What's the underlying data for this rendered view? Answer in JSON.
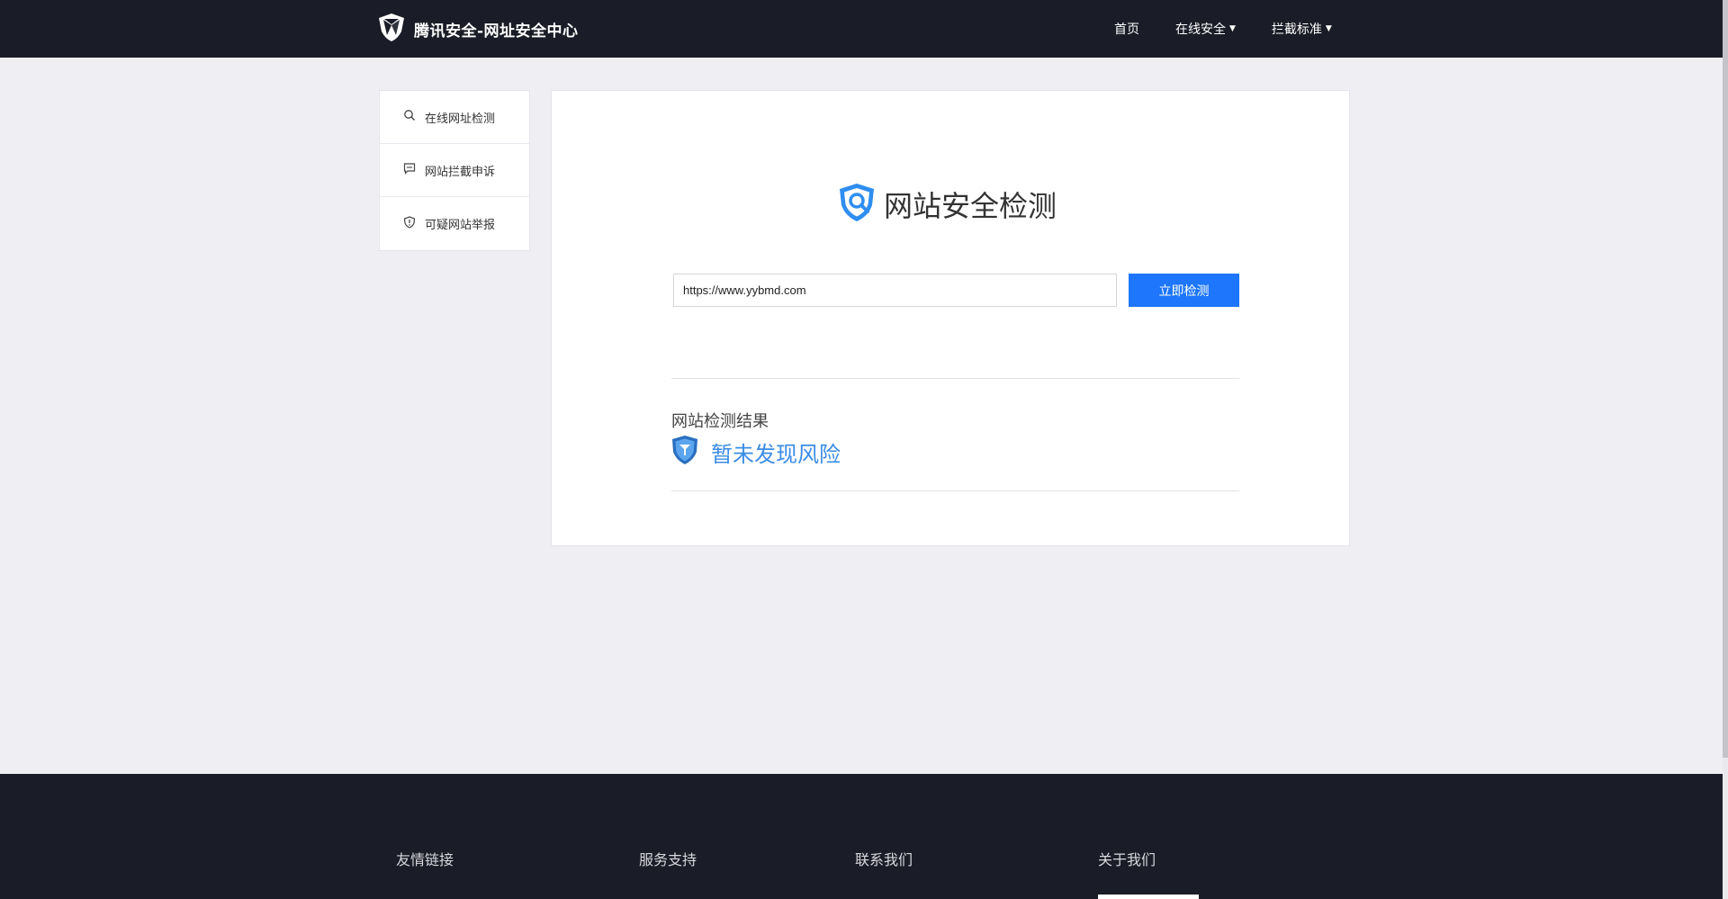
{
  "header": {
    "logo_text": "腾讯安全-网址安全中心",
    "nav": [
      {
        "label": "首页"
      },
      {
        "label": "在线安全"
      },
      {
        "label": "拦截标准"
      }
    ]
  },
  "sidebar": {
    "items": [
      {
        "label": "在线网址检测",
        "icon": "search-icon"
      },
      {
        "label": "网站拦截申诉",
        "icon": "chat-icon"
      },
      {
        "label": "可疑网站举报",
        "icon": "shield-alert-icon"
      }
    ]
  },
  "main": {
    "title": "网站安全检测",
    "url_value": "https://www.yybmd.com",
    "check_button": "立即检测",
    "result_label": "网站检测结果",
    "result_status": "暂未发现风险"
  },
  "footer": {
    "columns": [
      {
        "label": "友情链接"
      },
      {
        "label": "服务支持"
      },
      {
        "label": "联系我们"
      },
      {
        "label": "关于我们"
      }
    ]
  },
  "colors": {
    "header_bg": "#1a1c27",
    "page_bg": "#efeff3",
    "accent": "#1d76fb",
    "result_text": "#3a8ce6"
  }
}
